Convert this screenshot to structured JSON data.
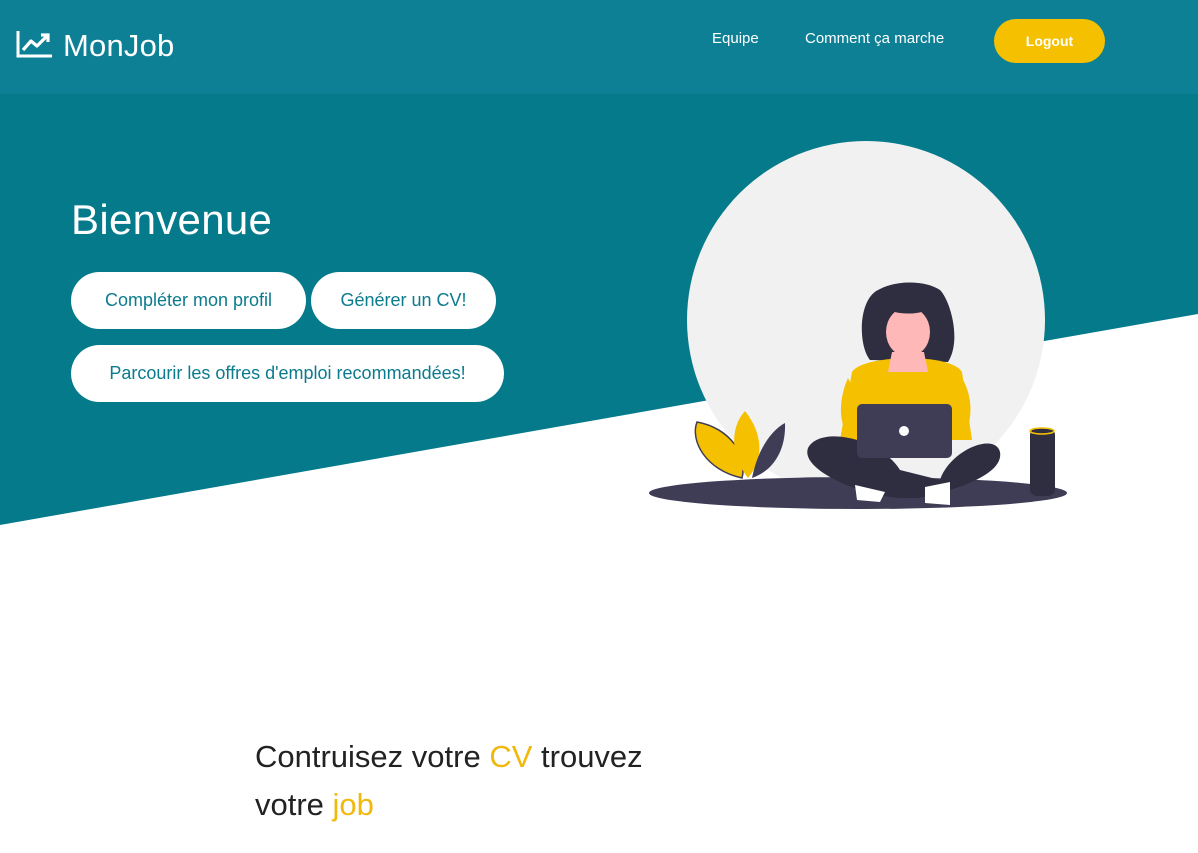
{
  "navbar": {
    "brand": "MonJob",
    "links": [
      "Equipe",
      "Comment ça marche"
    ],
    "logout_label": "Logout"
  },
  "hero": {
    "title": "Bienvenue",
    "buttons": [
      "Compléter mon profil",
      "Générer un CV!",
      "Parcourir les offres d'emploi recommandées!"
    ]
  },
  "tagline": {
    "part1": "Contruisez votre ",
    "highlight1": "CV",
    "part2": " trouvez votre ",
    "highlight2": "job"
  },
  "colors": {
    "navbar": "#0e8096",
    "hero": "#057a8b",
    "accent": "#f5c000",
    "button_text": "#0b7b8d"
  },
  "icons": {
    "brand": "trending-up-icon"
  }
}
